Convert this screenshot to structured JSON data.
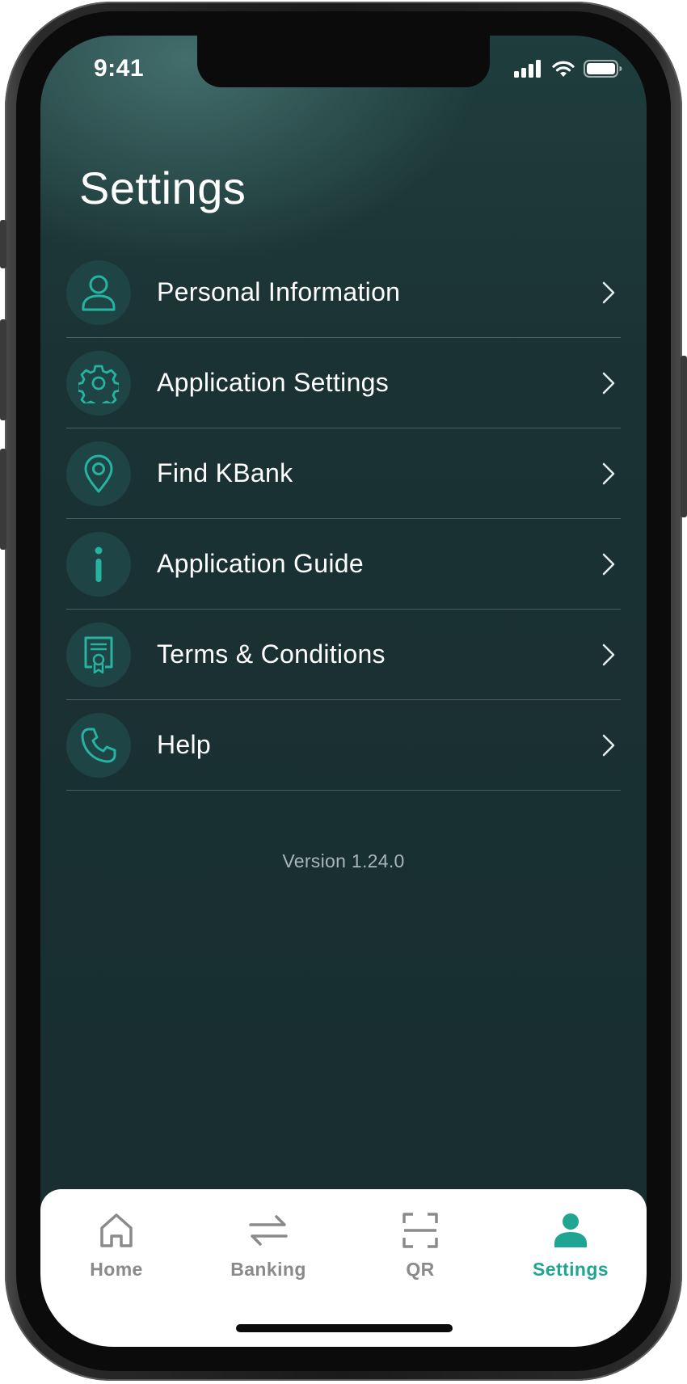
{
  "status_bar": {
    "time": "9:41"
  },
  "page": {
    "title": "Settings"
  },
  "menu": {
    "items": [
      {
        "label": "Personal Information",
        "icon": "person-icon"
      },
      {
        "label": "Application Settings",
        "icon": "gear-icon"
      },
      {
        "label": "Find KBank",
        "icon": "location-pin-icon"
      },
      {
        "label": "Application Guide",
        "icon": "info-icon"
      },
      {
        "label": "Terms & Conditions",
        "icon": "document-certificate-icon"
      },
      {
        "label": "Help",
        "icon": "phone-icon"
      }
    ]
  },
  "version": "Version 1.24.0",
  "tabs": [
    {
      "label": "Home",
      "icon": "home-icon",
      "active": false
    },
    {
      "label": "Banking",
      "icon": "transfer-arrows-icon",
      "active": false
    },
    {
      "label": "QR",
      "icon": "qr-scan-icon",
      "active": false
    },
    {
      "label": "Settings",
      "icon": "user-icon",
      "active": true
    }
  ],
  "colors": {
    "accent": "#1fa592",
    "background": "#172d30",
    "inactive_tab": "#8a8a8a"
  }
}
